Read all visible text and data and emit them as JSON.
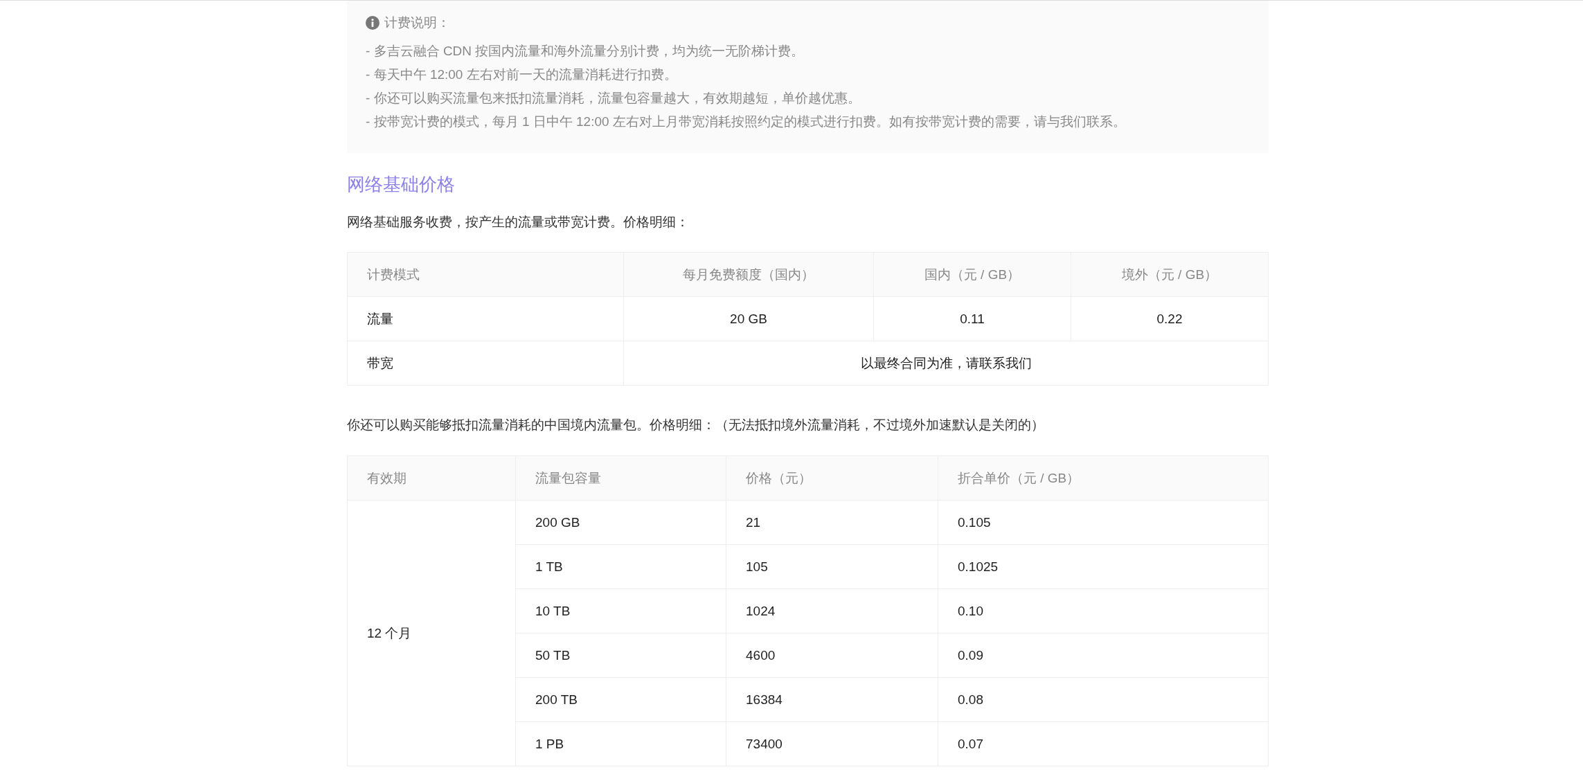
{
  "notice": {
    "title": "计费说明：",
    "items": [
      "- 多吉云融合 CDN 按国内流量和海外流量分别计费，均为统一无阶梯计费。",
      "- 每天中午 12:00 左右对前一天的流量消耗进行扣费。",
      "- 你还可以购买流量包来抵扣流量消耗，流量包容量越大，有效期越短，单价越优惠。",
      "- 按带宽计费的模式，每月 1 日中午 12:00 左右对上月带宽消耗按照约定的模式进行扣费。如有按带宽计费的需要，请与我们联系。"
    ]
  },
  "section": {
    "heading": "网络基础价格",
    "intro": "网络基础服务收费，按产生的流量或带宽计费。价格明细：",
    "table": {
      "columns": [
        "计费模式",
        "每月免费额度（国内）",
        "国内（元 / GB）",
        "境外（元 / GB）"
      ],
      "rows": [
        [
          "流量",
          "20 GB",
          "0.11",
          "0.22"
        ],
        [
          "带宽",
          {
            "text": "以最终合同为准，请联系我们",
            "colspan": 3
          }
        ]
      ]
    }
  },
  "packages": {
    "intro": "你还可以购买能够抵扣流量消耗的中国境内流量包。价格明细：（无法抵扣境外流量消耗，不过境外加速默认是关闭的）",
    "columns": [
      "有效期",
      "流量包容量",
      "价格（元）",
      "折合单价（元 / GB）"
    ],
    "rows": [
      [
        {
          "text": "12 个月",
          "rowspan": 6
        },
        "200 GB",
        "21",
        "0.105"
      ],
      [
        "1 TB",
        "105",
        "0.1025"
      ],
      [
        "10 TB",
        "1024",
        "0.10"
      ],
      [
        "50 TB",
        "4600",
        "0.09"
      ],
      [
        "200 TB",
        "16384",
        "0.08"
      ],
      [
        "1 PB",
        "73400",
        "0.07"
      ]
    ]
  }
}
